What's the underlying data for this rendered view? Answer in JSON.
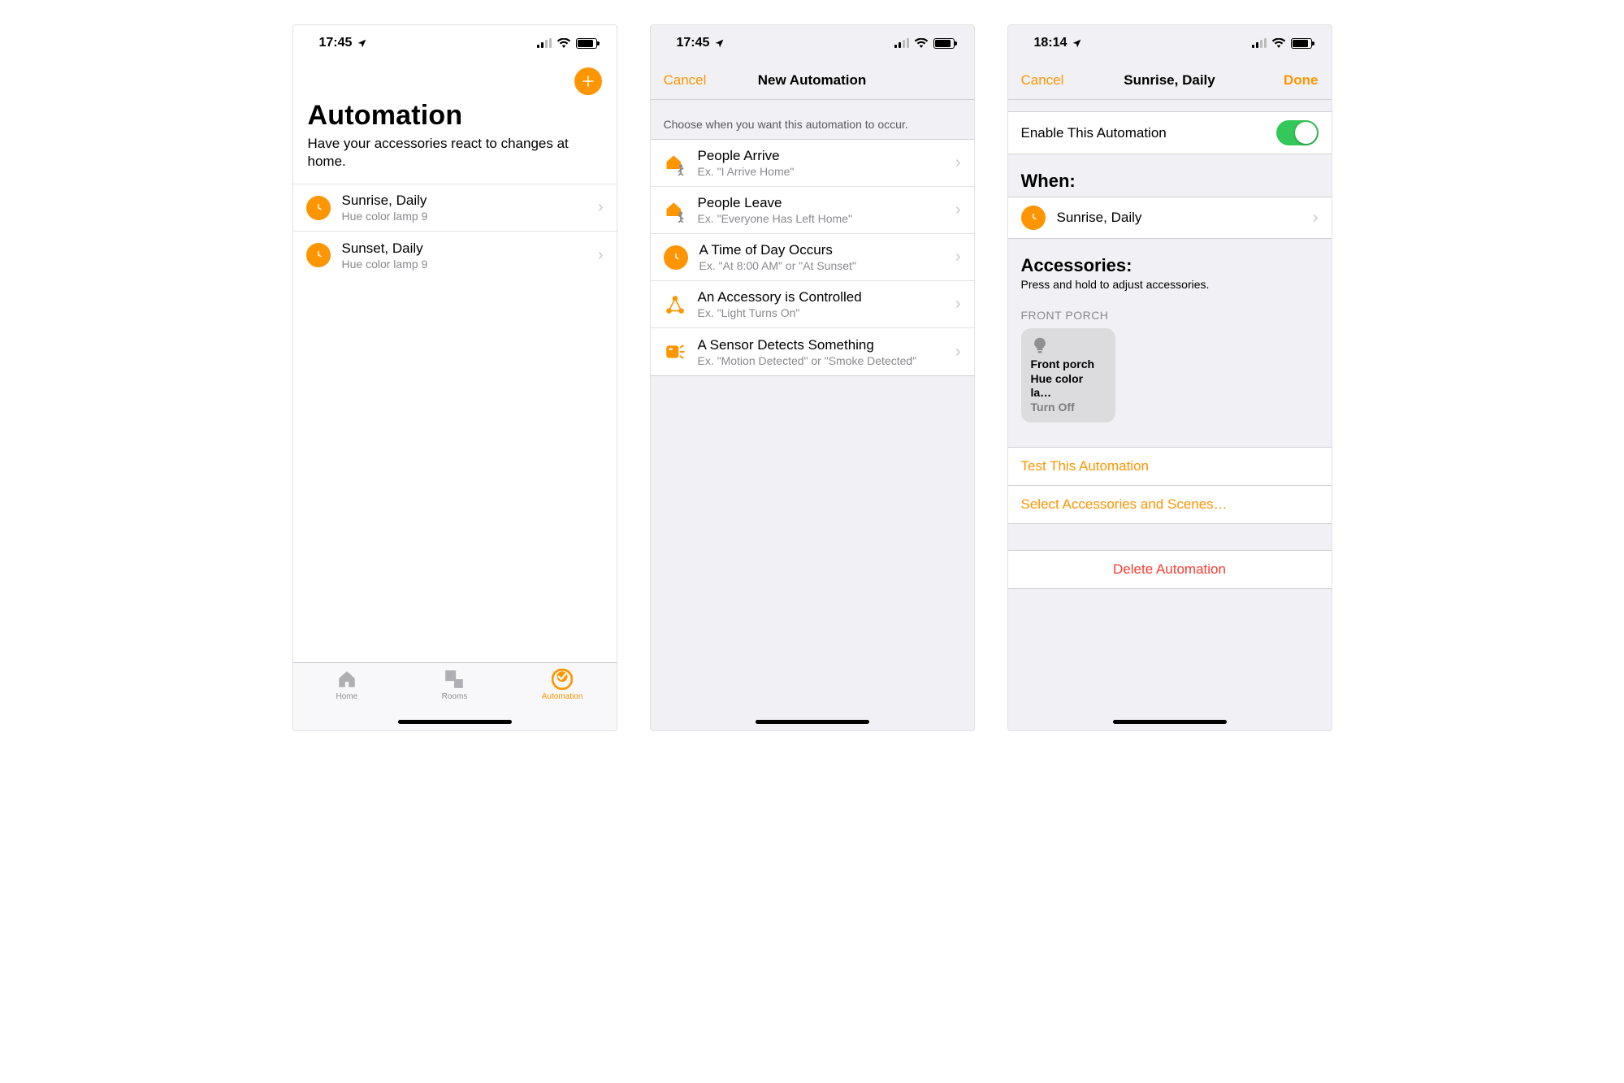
{
  "screen1": {
    "time": "17:45",
    "title": "Automation",
    "subtitle": "Have your accessories react to changes at home.",
    "items": [
      {
        "title": "Sunrise, Daily",
        "sub": "Hue color lamp 9"
      },
      {
        "title": "Sunset, Daily",
        "sub": "Hue color lamp 9"
      }
    ],
    "tabs": {
      "home": "Home",
      "rooms": "Rooms",
      "automation": "Automation"
    }
  },
  "screen2": {
    "time": "17:45",
    "cancel": "Cancel",
    "title": "New Automation",
    "prompt": "Choose when you want this automation to occur.",
    "options": [
      {
        "title": "People Arrive",
        "sub": "Ex. \"I Arrive Home\""
      },
      {
        "title": "People Leave",
        "sub": "Ex. \"Everyone Has Left Home\""
      },
      {
        "title": "A Time of Day Occurs",
        "sub": "Ex. \"At 8:00 AM\" or \"At Sunset\""
      },
      {
        "title": "An Accessory is Controlled",
        "sub": "Ex. \"Light Turns On\""
      },
      {
        "title": "A Sensor Detects Something",
        "sub": "Ex. \"Motion Detected\" or \"Smoke Detected\""
      }
    ]
  },
  "screen3": {
    "time": "18:14",
    "cancel": "Cancel",
    "title": "Sunrise, Daily",
    "done": "Done",
    "enable_label": "Enable This Automation",
    "when_header": "When:",
    "when_value": "Sunrise, Daily",
    "acc_header": "Accessories:",
    "acc_hint": "Press and hold to adjust accessories.",
    "room": "FRONT PORCH",
    "tile": {
      "line1": "Front porch",
      "line2": "Hue color la…",
      "state": "Turn Off"
    },
    "test": "Test This Automation",
    "select": "Select Accessories and Scenes…",
    "delete": "Delete Automation"
  }
}
